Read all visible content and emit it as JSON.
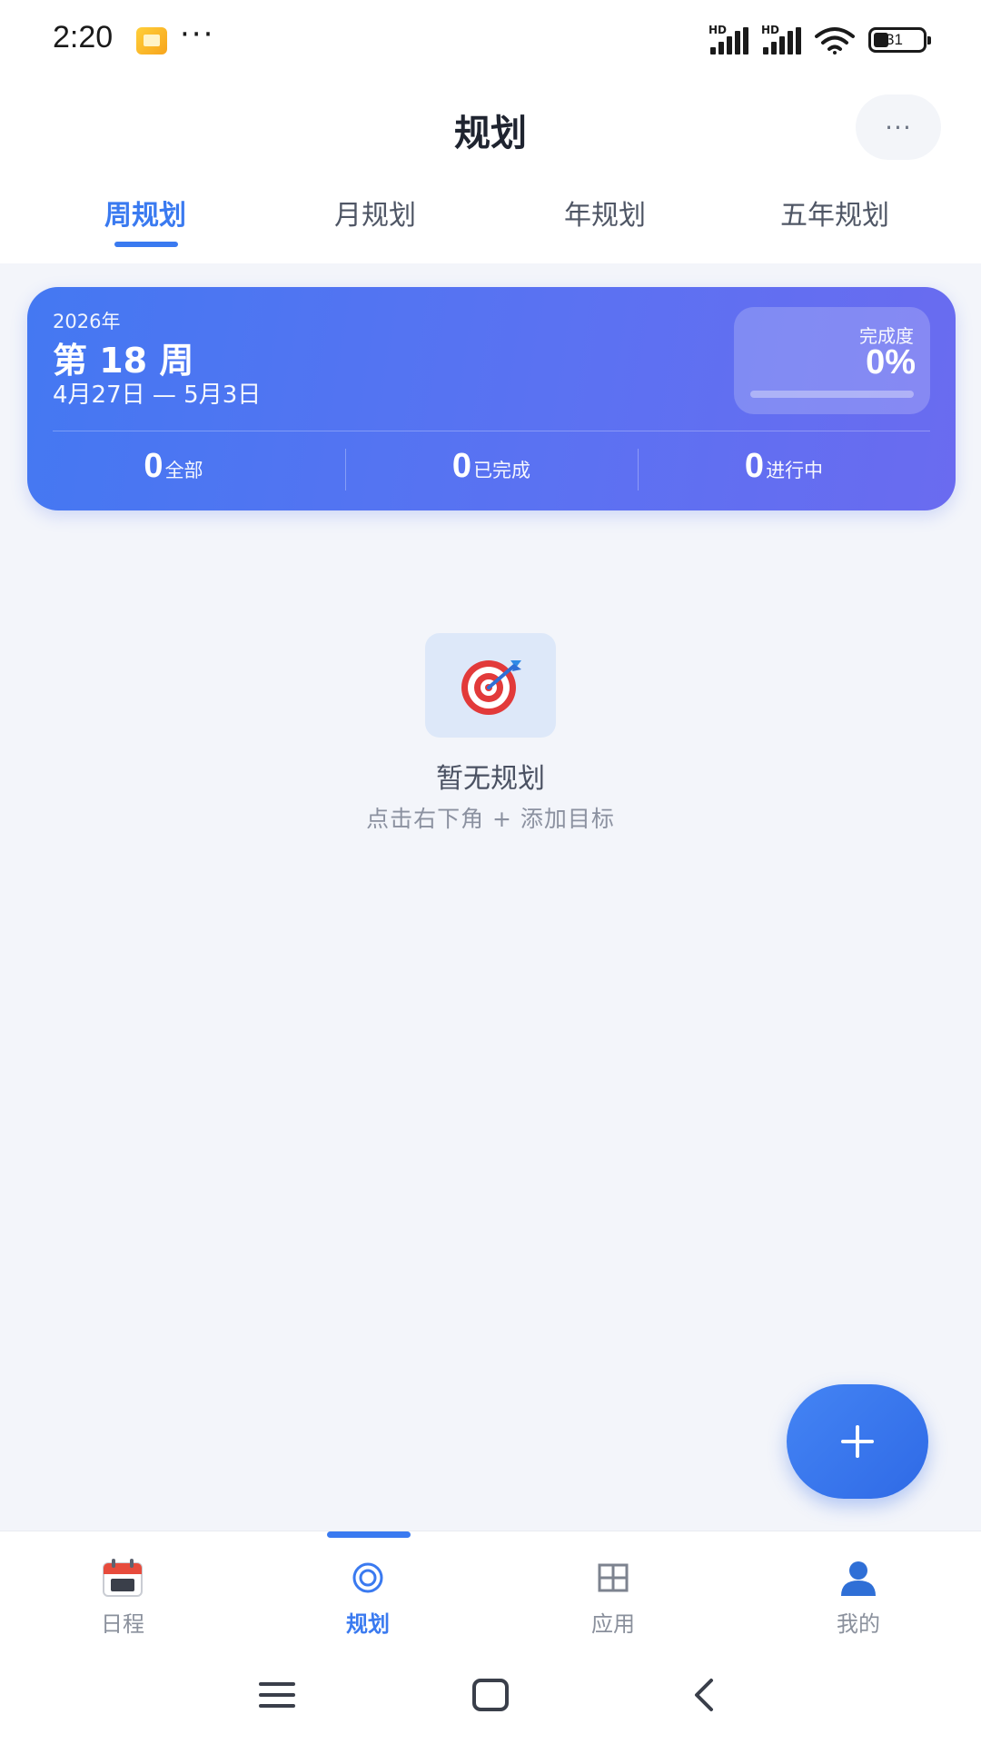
{
  "status_bar": {
    "time": "2:20",
    "more": "···",
    "signal_label": "HD",
    "battery": "31"
  },
  "header": {
    "title": "规划",
    "more_label": "···"
  },
  "tabs": [
    {
      "label": "周规划",
      "active": true
    },
    {
      "label": "月规划",
      "active": false
    },
    {
      "label": "年规划",
      "active": false
    },
    {
      "label": "五年规划",
      "active": false
    }
  ],
  "week_card": {
    "year": "2026年",
    "week": "第 18 周",
    "range": "4月27日 — 5月3日",
    "completion_label": "完成度",
    "completion_value": "0%",
    "completion_fraction": 0,
    "stats": [
      {
        "count": "0",
        "label": "全部"
      },
      {
        "count": "0",
        "label": "已完成"
      },
      {
        "count": "0",
        "label": "进行中"
      }
    ]
  },
  "empty_state": {
    "icon": "target-icon",
    "title": "暂无规划",
    "hint": "点击右下角 + 添加目标"
  },
  "fab": {
    "icon": "plus-icon"
  },
  "bottom_nav": [
    {
      "label": "日程",
      "icon": "calendar-icon",
      "active": false
    },
    {
      "label": "规划",
      "icon": "target-outline-icon",
      "active": true
    },
    {
      "label": "应用",
      "icon": "grid-icon",
      "active": false
    },
    {
      "label": "我的",
      "icon": "user-icon",
      "active": false
    }
  ],
  "system_nav": {
    "icons": [
      "menu-icon",
      "home-icon",
      "back-icon"
    ]
  },
  "colors": {
    "accent": "#3a7af0",
    "card_gradient_start": "#4478f2",
    "card_gradient_end": "#6a6bf0",
    "background": "#f3f5fa"
  }
}
